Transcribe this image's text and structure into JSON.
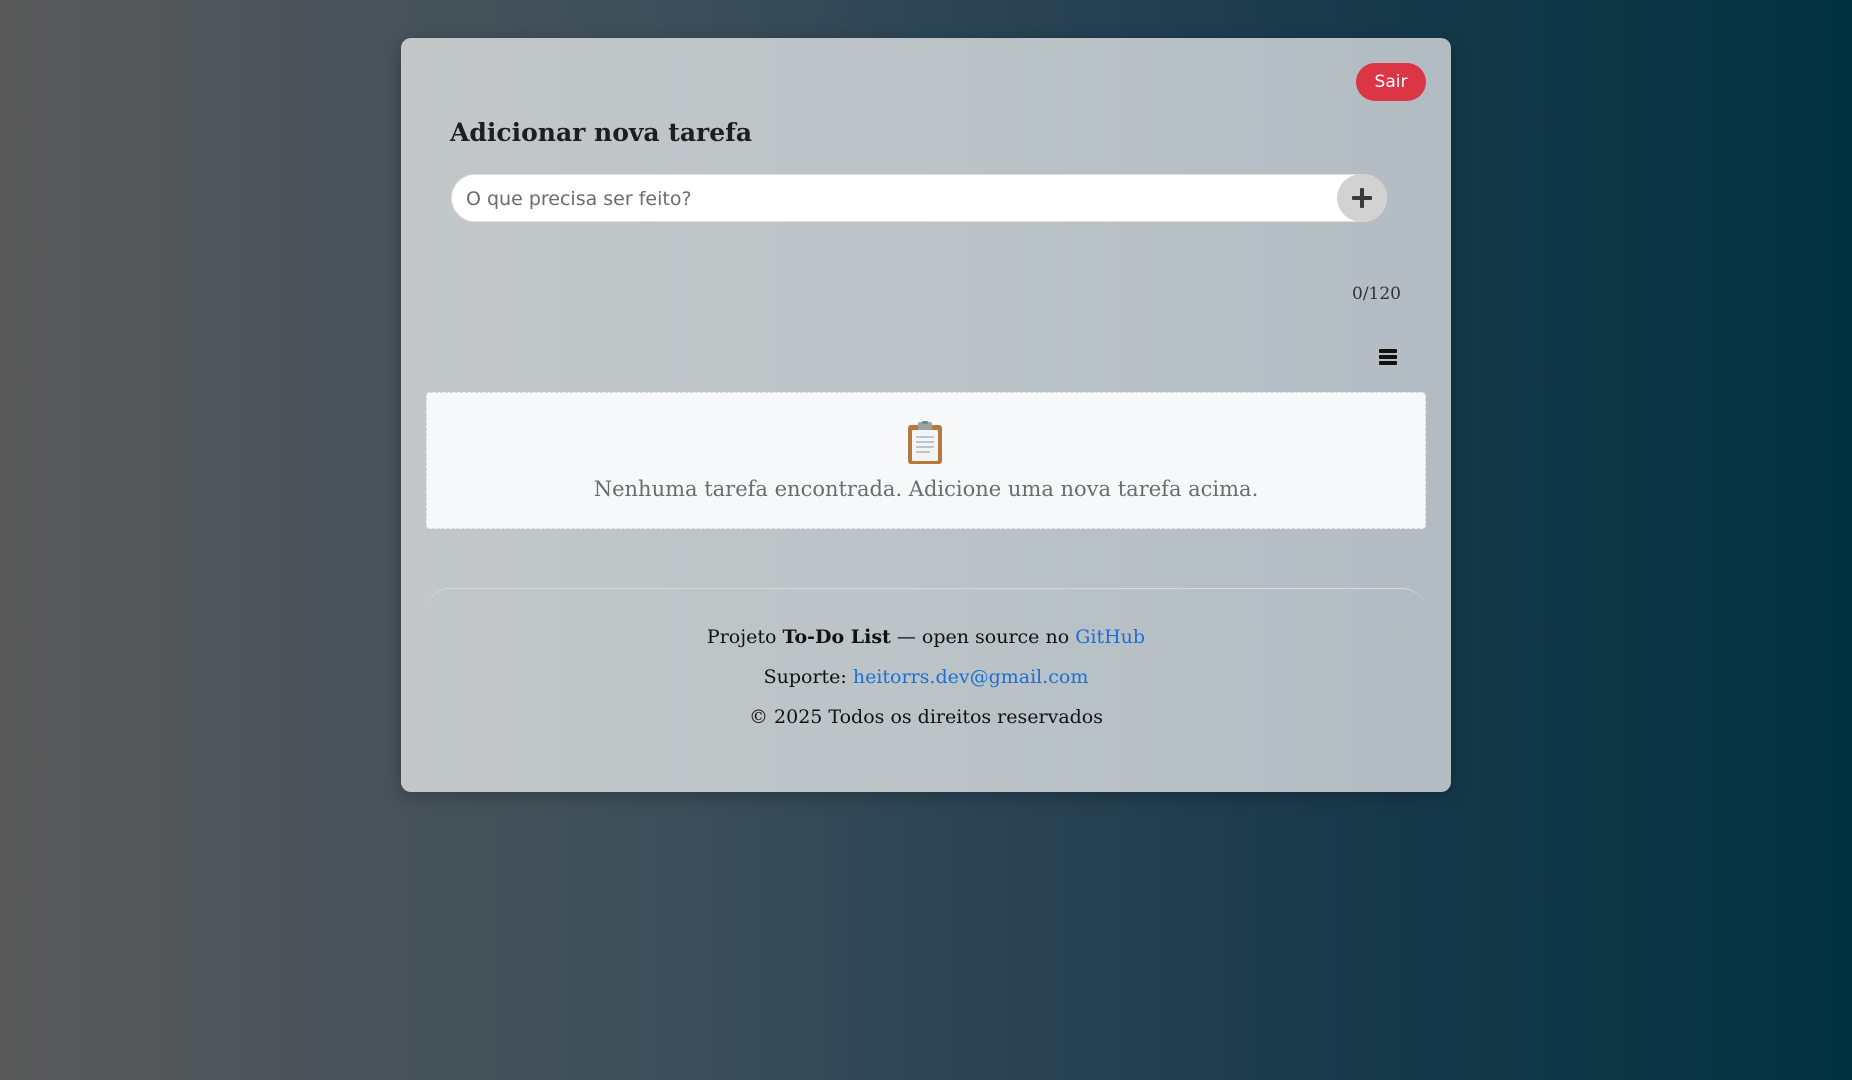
{
  "header": {
    "logout_label": "Sair"
  },
  "add_task": {
    "title": "Adicionar nova tarefa",
    "input_placeholder": "O que precisa ser feito?",
    "input_value": "",
    "char_counter": "0/120"
  },
  "tasks": {
    "empty_message": "Nenhuma tarefa encontrada. Adicione uma nova tarefa acima.",
    "empty_icon": "clipboard-icon"
  },
  "footer": {
    "project_prefix": "Projeto",
    "project_name": "To-Do List",
    "project_middle": "— open source no",
    "github_label": "GitHub",
    "support_prefix": "Suporte:",
    "support_email": "heitorrs.dev@gmail.com",
    "copyright": "© 2025 Todos os direitos reservados"
  },
  "colors": {
    "logout_button": "#dc3545",
    "link": "#1a6fd8",
    "empty_box_bg": "#f7f8f9"
  }
}
